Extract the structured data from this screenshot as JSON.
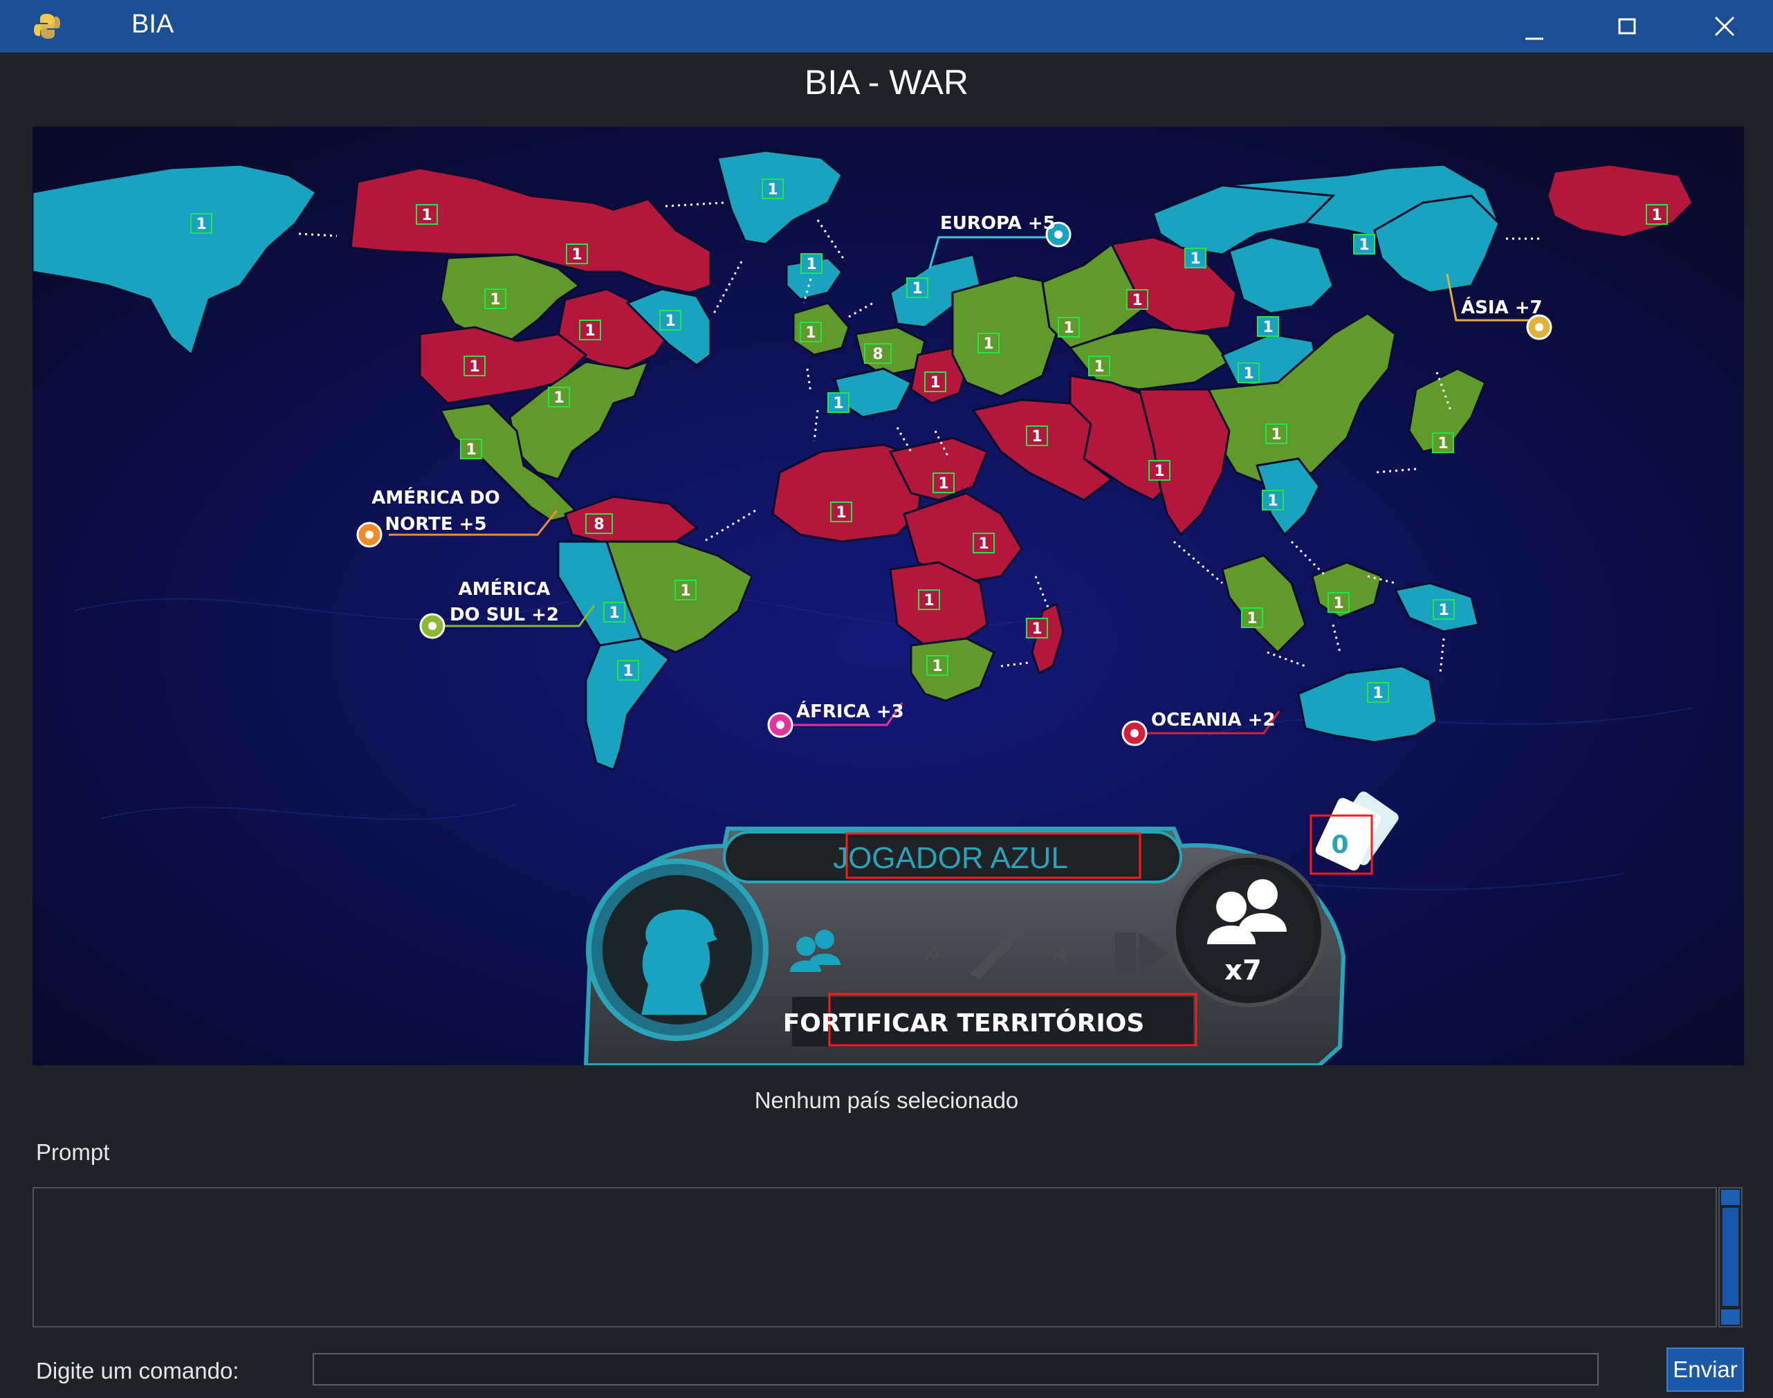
{
  "window": {
    "title": "BIA"
  },
  "header": {
    "title": "BIA - WAR"
  },
  "colors": {
    "blue": "#1aa3bf",
    "red": "#b3173c",
    "green": "#5f9a2a",
    "ocean": "#0b0d35",
    "accent": "#1c5aa8"
  },
  "continent_labels": {
    "europa": "EUROPA +5",
    "asia": "ÁSIA +7",
    "america_norte_1": "AMÉRICA DO",
    "america_norte_2": "NORTE +5",
    "america_sul_1": "AMÉRICA",
    "america_sul_2": "DO SUL +2",
    "africa": "ÁFRICA +3",
    "oceania": "OCEANIA +2"
  },
  "territories": {
    "alaska": "1",
    "mackenzie": "1",
    "vancouver": "1",
    "ottawa": "1",
    "groenlandia": "1",
    "labrador": "1",
    "california": "1",
    "nova_york": "1",
    "mexico": "1",
    "islandia": "1",
    "inglaterra": "1",
    "suecia": "1",
    "franca": "8",
    "alemanha": "1",
    "polonia": "1",
    "moscou": "1",
    "portugal": "1",
    "omsk": "1",
    "dudinka": "1",
    "siberia": "1",
    "vladivostok": "1",
    "tchita": "1",
    "mongolia": "1",
    "aral": "1",
    "china": "1",
    "japao": "1",
    "oriente_medio": "1",
    "india": "1",
    "vietna": "1",
    "argelia": "1",
    "egito": "1",
    "sudao": "1",
    "congo": "1",
    "africa_sul": "1",
    "madagascar": "1",
    "venezuela": "8",
    "brasil": "1",
    "peru": "1",
    "argentina": "1",
    "sumatra": "1",
    "borneo": "1",
    "nova_guine": "1",
    "australia": "1"
  },
  "player_panel": {
    "player_name": "JOGADOR AZUL",
    "phase_label": "FORTIFICAR TERRITÓRIOS",
    "cards_count": "0",
    "troops_label": "x7",
    "icons": [
      "soldier-silhouette-icon",
      "troops-icon",
      "chevrons-icon",
      "rifle-icon",
      "move-troops-icon"
    ]
  },
  "status": {
    "text": "Nenhum país selecionado"
  },
  "prompt": {
    "label": "Prompt",
    "value": ""
  },
  "command": {
    "label": "Digite um comando:",
    "value": "",
    "send_label": "Enviar"
  }
}
